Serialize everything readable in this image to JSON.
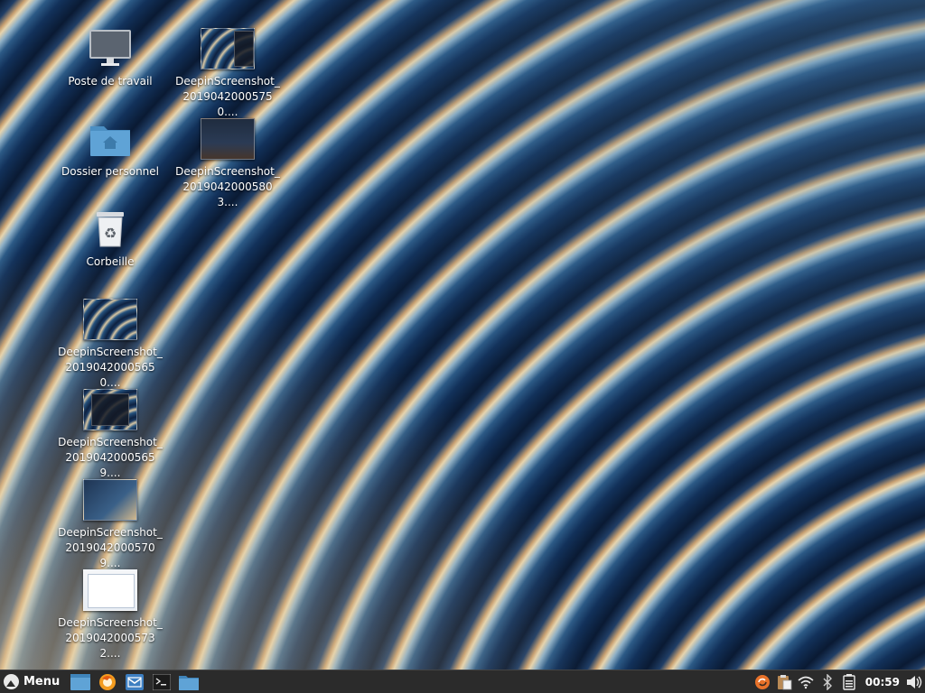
{
  "desktop": {
    "icons": [
      {
        "label": "Poste de travail",
        "icon": "computer-icon"
      },
      {
        "label": "Dossier personnel",
        "icon": "home-folder-icon"
      },
      {
        "label": "Corbeille",
        "icon": "trash-icon"
      },
      {
        "label": "DeepinScreenshot_\n20190420005650....",
        "icon": "image-thumbnail-icon"
      },
      {
        "label": "DeepinScreenshot_\n20190420005659....",
        "icon": "image-thumbnail-icon"
      },
      {
        "label": "DeepinScreenshot_\n20190420005709....",
        "icon": "image-thumbnail-icon"
      },
      {
        "label": "DeepinScreenshot_\n20190420005732....",
        "icon": "image-thumbnail-icon"
      },
      {
        "label": "DeepinScreenshot_\n20190420005750....",
        "icon": "image-thumbnail-icon"
      },
      {
        "label": "DeepinScreenshot_\n20190420005803....",
        "icon": "image-thumbnail-icon"
      }
    ]
  },
  "taskbar": {
    "menu_label": "Menu",
    "launchers": [
      "show-desktop-icon",
      "firefox-icon",
      "mail-icon",
      "terminal-icon",
      "file-manager-icon"
    ],
    "tray": [
      "update-manager-icon",
      "clipboard-icon",
      "wifi-icon",
      "bluetooth-icon",
      "battery-icon"
    ],
    "clock": "00:59",
    "volume_icon": "volume-icon"
  },
  "colors": {
    "taskbar_bg": "#2b2b2b",
    "folder_blue": "#5fa3d6",
    "firefox_orange": "#f39c1f"
  }
}
